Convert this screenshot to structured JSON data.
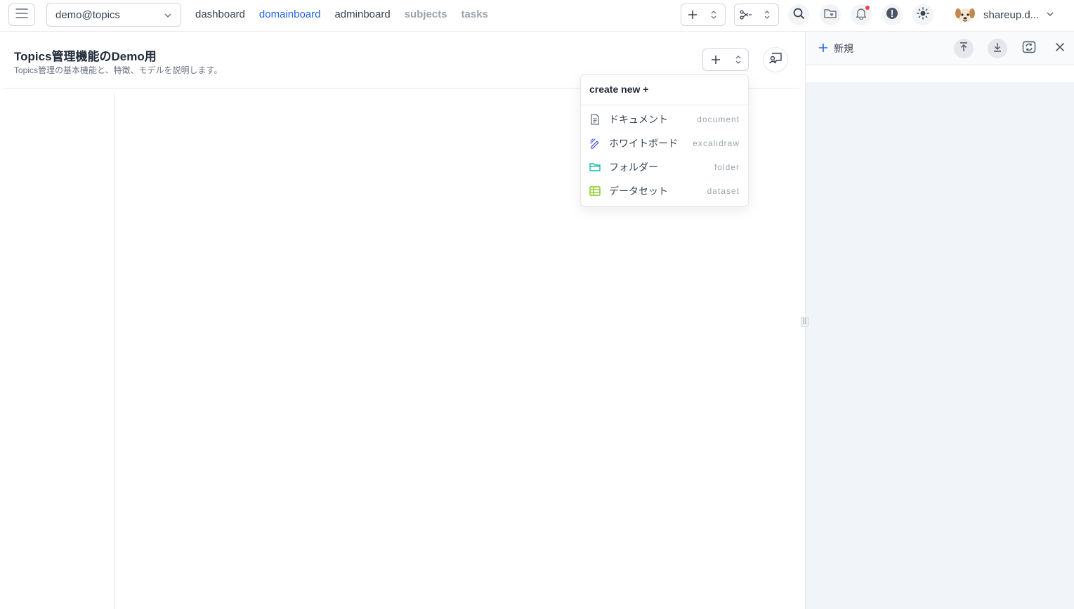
{
  "topbar": {
    "domain_select": "demo@topics",
    "nav": [
      {
        "label": "dashboard"
      },
      {
        "label": "domainboard"
      },
      {
        "label": "adminboard"
      },
      {
        "label": "subjects"
      },
      {
        "label": "tasks"
      }
    ],
    "user_name": "shareup.d...",
    "accent_color": "#2563eb",
    "icons": [
      "menu-icon",
      "plus-icon",
      "scissors-icon",
      "search-icon",
      "folder-heart-icon",
      "bell-icon",
      "alert-icon",
      "sun-icon"
    ]
  },
  "page": {
    "title": "Topics管理機能のDemo用",
    "subtitle": "Topics管理の基本機能と、特徴、モデルを説明します。"
  },
  "dropdown": {
    "heading": "create new +",
    "items": [
      {
        "label": "ドキュメント",
        "keyword": "document",
        "icon": "document-icon",
        "color": "#6b7280"
      },
      {
        "label": "ホワイトボード",
        "keyword": "excalidraw",
        "icon": "pen-icon",
        "color": "#6366f1"
      },
      {
        "label": "フォルダー",
        "keyword": "folder",
        "icon": "folder-icon",
        "color": "#14b8a6"
      },
      {
        "label": "データセット",
        "keyword": "dataset",
        "icon": "table-icon",
        "color": "#84cc16"
      }
    ]
  },
  "right_panel": {
    "new_label": "新規"
  }
}
